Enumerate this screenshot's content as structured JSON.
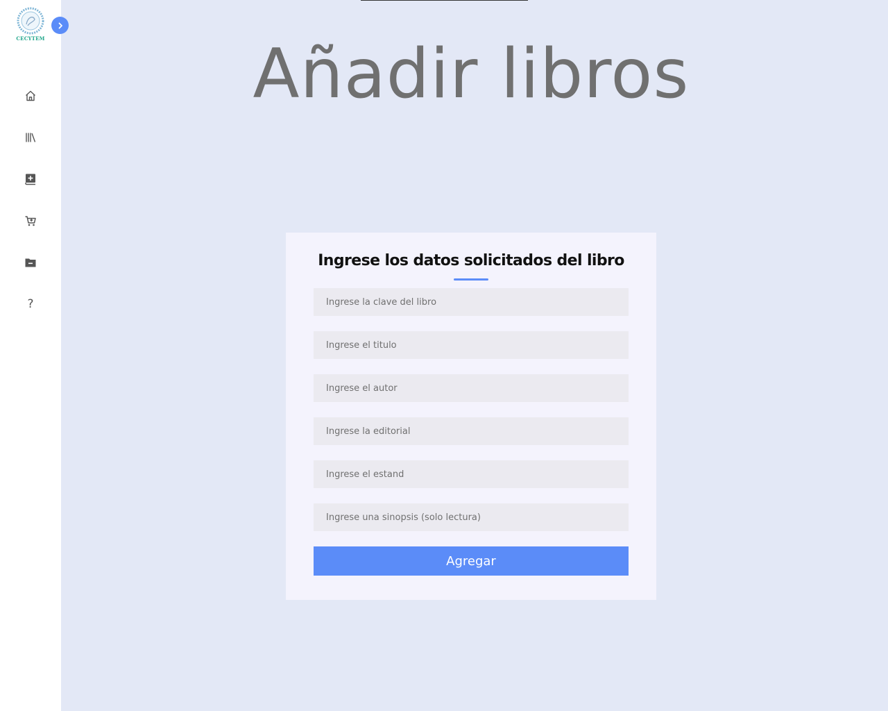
{
  "sidebar": {
    "logo_text": "CECYTEM",
    "toggle_icon": "chevron-right-icon",
    "items": [
      {
        "icon": "home-icon"
      },
      {
        "icon": "library-icon"
      },
      {
        "icon": "add-book-icon"
      },
      {
        "icon": "cart-icon"
      },
      {
        "icon": "folder-minus-icon"
      },
      {
        "icon": "help-icon",
        "glyph": "?"
      }
    ]
  },
  "page": {
    "title": "Añadir libros"
  },
  "form": {
    "title": "Ingrese los datos solicitados del libro",
    "fields": [
      {
        "placeholder": "Ingrese la clave del libro",
        "value": ""
      },
      {
        "placeholder": "Ingrese el titulo",
        "value": ""
      },
      {
        "placeholder": "Ingrese el autor",
        "value": ""
      },
      {
        "placeholder": "Ingrese la editorial",
        "value": ""
      },
      {
        "placeholder": "Ingrese el estand",
        "value": ""
      },
      {
        "placeholder": "Ingrese una sinopsis (solo lectura)",
        "value": ""
      }
    ],
    "submit_label": "Agregar"
  },
  "colors": {
    "accent": "#5b8cf8",
    "background": "#e3e8f6",
    "card": "#f4f3fd",
    "field": "#ebeaf0",
    "title": "#707070",
    "logo_text": "#1fa58a"
  }
}
